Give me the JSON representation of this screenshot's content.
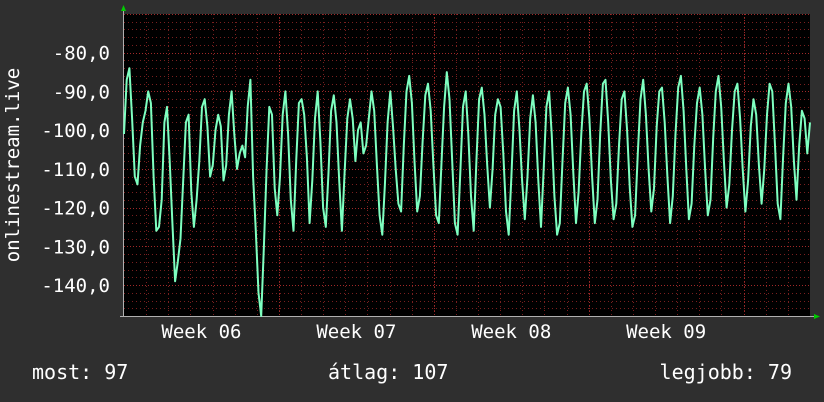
{
  "chart_data": {
    "type": "line",
    "ylabel": "onlinestream.live",
    "y_ticks": [
      "-80,0",
      "-90,0",
      "-100,0",
      "-110,0",
      "-120,0",
      "-130,0",
      "-140,0"
    ],
    "y_tick_values": [
      -80,
      -90,
      -100,
      -110,
      -120,
      -130,
      -140
    ],
    "ylim": [
      -148,
      -70
    ],
    "x_ticks": [
      "Week 06",
      "Week 07",
      "Week 08",
      "Week 09"
    ],
    "xlim_days": [
      0,
      31
    ],
    "x_tick_days": [
      3.5,
      10.5,
      17.5,
      24.5
    ],
    "grid": true,
    "colors": {
      "line": "#7effc0",
      "background": "#000000",
      "minor_grid": "#7a1f1f",
      "major_grid": "#a02828",
      "axis_arrow": "#00cc00"
    },
    "series": [
      {
        "values": [
          -101,
          -87,
          -84,
          -97,
          -112,
          -114,
          -104,
          -98,
          -95,
          -90,
          -93,
          -112,
          -126,
          -125,
          -118,
          -98,
          -94,
          -108,
          -124,
          -139,
          -134,
          -128,
          -113,
          -98,
          -96,
          -116,
          -125,
          -118,
          -108,
          -94,
          -92,
          -99,
          -112,
          -109,
          -100,
          -96,
          -99,
          -113,
          -109,
          -96,
          -90,
          -101,
          -110,
          -106,
          -104,
          -107,
          -94,
          -87,
          -112,
          -126,
          -142,
          -148,
          -130,
          -110,
          -94,
          -96,
          -115,
          -122,
          -112,
          -96,
          -90,
          -101,
          -118,
          -126,
          -108,
          -93,
          -92,
          -96,
          -107,
          -124,
          -113,
          -97,
          -90,
          -103,
          -120,
          -125,
          -111,
          -95,
          -91,
          -98,
          -113,
          -126,
          -111,
          -97,
          -92,
          -97,
          -108,
          -100,
          -98,
          -106,
          -104,
          -97,
          -90,
          -95,
          -109,
          -122,
          -127,
          -114,
          -98,
          -90,
          -99,
          -110,
          -119,
          -121,
          -104,
          -90,
          -86,
          -93,
          -108,
          -121,
          -117,
          -103,
          -91,
          -88,
          -95,
          -109,
          -122,
          -124,
          -109,
          -94,
          -85,
          -92,
          -108,
          -124,
          -127,
          -111,
          -94,
          -90,
          -101,
          -117,
          -126,
          -108,
          -92,
          -89,
          -96,
          -109,
          -120,
          -110,
          -96,
          -92,
          -94,
          -106,
          -121,
          -127,
          -112,
          -95,
          -90,
          -100,
          -113,
          -123,
          -112,
          -97,
          -91,
          -98,
          -113,
          -125,
          -110,
          -94,
          -90,
          -101,
          -117,
          -127,
          -124,
          -108,
          -93,
          -89,
          -96,
          -111,
          -124,
          -116,
          -101,
          -90,
          -88,
          -97,
          -112,
          -124,
          -118,
          -101,
          -88,
          -87,
          -98,
          -113,
          -123,
          -119,
          -104,
          -92,
          -90,
          -100,
          -115,
          -125,
          -122,
          -106,
          -92,
          -87,
          -96,
          -110,
          -121,
          -115,
          -99,
          -90,
          -89,
          -98,
          -112,
          -124,
          -117,
          -101,
          -89,
          -86,
          -95,
          -110,
          -123,
          -119,
          -104,
          -93,
          -89,
          -96,
          -110,
          -122,
          -118,
          -102,
          -90,
          -86,
          -94,
          -108,
          -120,
          -114,
          -100,
          -90,
          -88,
          -97,
          -110,
          -121,
          -113,
          -99,
          -92,
          -96,
          -109,
          -119,
          -110,
          -96,
          -88,
          -90,
          -104,
          -119,
          -123,
          -107,
          -93,
          -88,
          -94,
          -108,
          -118,
          -104,
          -95,
          -97,
          -106,
          -98
        ]
      }
    ],
    "stats": {
      "now_label": "most:",
      "now_value": "97",
      "avg_label": "átlag:",
      "avg_value": "107",
      "best_label": "legjobb:",
      "best_value": "79"
    }
  }
}
